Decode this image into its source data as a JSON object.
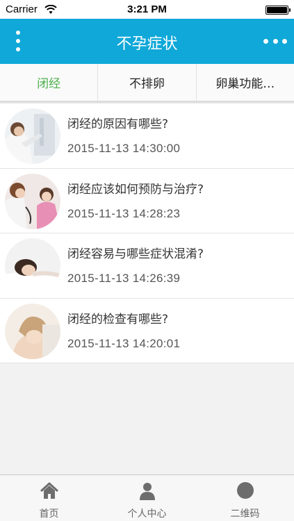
{
  "status_bar": {
    "carrier": "Carrier",
    "time": "3:21 PM"
  },
  "nav": {
    "title": "不孕症状"
  },
  "tabs": [
    {
      "label": "闭经",
      "active": true
    },
    {
      "label": "不排卵",
      "active": false
    },
    {
      "label": "卵巢功能…",
      "active": false
    }
  ],
  "articles": [
    {
      "title": "闭经的原因有哪些?",
      "date": "2015-11-13 14:30:00"
    },
    {
      "title": "闭经应该如何预防与治疗?",
      "date": "2015-11-13 14:28:23"
    },
    {
      "title": "闭经容易与哪些症状混淆?",
      "date": "2015-11-13 14:26:39"
    },
    {
      "title": "闭经的检查有哪些?",
      "date": "2015-11-13 14:20:01"
    }
  ],
  "tab_bar": [
    {
      "label": "首页",
      "icon": "home-icon"
    },
    {
      "label": "个人中心",
      "icon": "person-icon"
    },
    {
      "label": "二维码",
      "icon": "qrcode-icon"
    }
  ],
  "colors": {
    "nav_bg": "#0fa8d8",
    "active_tab": "#4cae4c",
    "icon_gray": "#6d6d6d"
  }
}
